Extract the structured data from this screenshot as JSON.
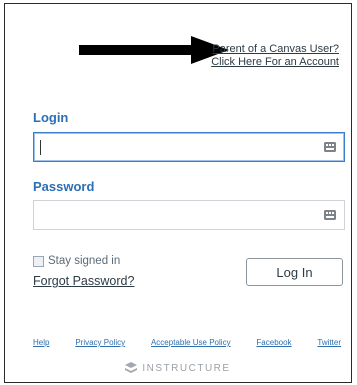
{
  "parent_link": {
    "line1": "Parent of a Canvas User?",
    "line2": "Click Here For an Account"
  },
  "login": {
    "label": "Login",
    "value": ""
  },
  "password": {
    "label": "Password",
    "value": ""
  },
  "stay_signed_in": {
    "label": "Stay signed in",
    "checked": false
  },
  "forgot_password": "Forgot Password?",
  "login_button": "Log In",
  "footer": {
    "links": [
      "Help",
      "Privacy Policy",
      "Acceptable Use Policy",
      "Facebook",
      "Twitter"
    ],
    "brand": "INSTRUCTURE"
  },
  "colors": {
    "accent": "#2b6fb6",
    "arrow": "#000000",
    "border": "#2b2b2b"
  },
  "icons": [
    "arrow-right-icon",
    "keypass-icon",
    "instructure-logo-icon"
  ]
}
